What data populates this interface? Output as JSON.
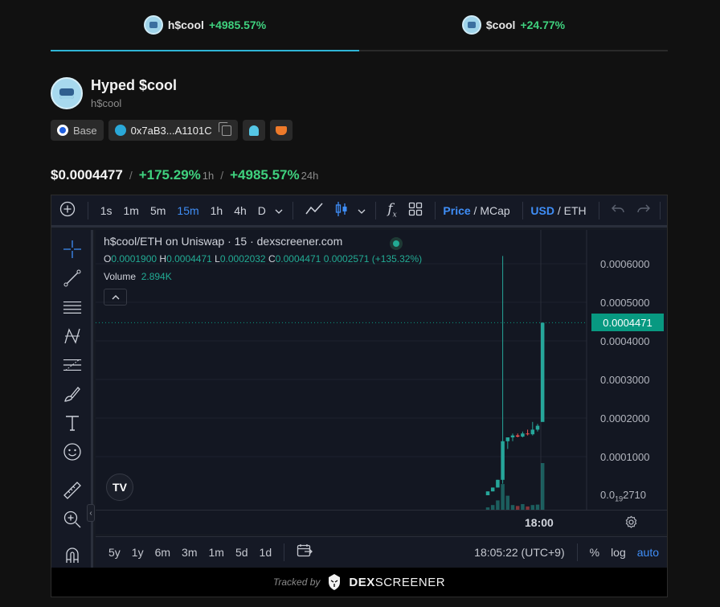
{
  "tabs": [
    {
      "symbol": "h$cool",
      "change": "+4985.57%",
      "active": true
    },
    {
      "symbol": "$cool",
      "change": "+24.77%",
      "active": false
    }
  ],
  "token": {
    "name": "Hyped $cool",
    "symbol": "h$cool",
    "chain": "Base",
    "address": "0x7aB3...A1101C"
  },
  "price": {
    "usd": "$0.0004477",
    "change_1h": "+175.29%",
    "label_1h": "1h",
    "change_24h": "+4985.57%",
    "label_24h": "24h"
  },
  "toolbar": {
    "intervals": [
      "1s",
      "1m",
      "5m",
      "15m",
      "1h",
      "4h",
      "D"
    ],
    "selected_interval": "15m",
    "price_label": "Price",
    "mcap_label": "MCap",
    "usd_label": "USD",
    "eth_label": "ETH"
  },
  "legend": {
    "title": "h$cool/ETH on Uniswap · 15 · dexscreener.com",
    "o_label": "O",
    "o": "0.0001900",
    "h_label": "H",
    "h": "0.0004471",
    "l_label": "L",
    "l": "0.0002032",
    "c_label": "C",
    "c": "0.0004471",
    "change": "0.0002571 (+135.32%)",
    "volume_label": "Volume",
    "volume": "2.894K"
  },
  "chart": {
    "y_ticks": [
      "0.0006000",
      "0.0005000",
      "0.0004000",
      "0.0003000",
      "0.0002000",
      "0.0001000"
    ],
    "low_tick_prefix": "0.0",
    "low_tick_sub": "19",
    "low_tick_suffix": "2710",
    "last_price": "0.0004471",
    "time_label": "18:00",
    "up_color": "#26a69a",
    "down_color": "#ef5350"
  },
  "chart_data": {
    "type": "candlestick",
    "title": "h$cool/ETH on Uniswap · 15 · dexscreener.com",
    "ylim": [
      0,
      0.00065
    ],
    "candles": [
      {
        "o": 0.0,
        "h": 1e-05,
        "l": 0.0,
        "c": 1e-05,
        "v": 0.05
      },
      {
        "o": 1e-05,
        "h": 2e-05,
        "l": 1e-05,
        "c": 2e-05,
        "v": 0.1
      },
      {
        "o": 2e-05,
        "h": 4e-05,
        "l": 2e-05,
        "c": 4e-05,
        "v": 0.2
      },
      {
        "o": 4e-05,
        "h": 0.00062,
        "l": 3e-05,
        "c": 0.00014,
        "v": 0.55
      },
      {
        "o": 0.00014,
        "h": 0.00015,
        "l": 0.00012,
        "c": 0.00015,
        "v": 0.3
      },
      {
        "o": 0.00015,
        "h": 0.00016,
        "l": 0.00014,
        "c": 0.000155,
        "v": 0.1
      },
      {
        "o": 0.000155,
        "h": 0.00016,
        "l": 0.00015,
        "c": 0.000152,
        "v": 0.08
      },
      {
        "o": 0.000152,
        "h": 0.000165,
        "l": 0.00015,
        "c": 0.00016,
        "v": 0.12
      },
      {
        "o": 0.00016,
        "h": 0.00017,
        "l": 0.000155,
        "c": 0.000158,
        "v": 0.07
      },
      {
        "o": 0.000158,
        "h": 0.00019,
        "l": 0.000155,
        "c": 0.00017,
        "v": 0.1
      },
      {
        "o": 0.00017,
        "h": 0.000185,
        "l": 0.000165,
        "c": 0.00018,
        "v": 0.11
      },
      {
        "o": 0.00019,
        "h": 0.0004471,
        "l": 0.0002032,
        "c": 0.0004471,
        "v": 1.0
      }
    ]
  },
  "bottombar": {
    "ranges": [
      "5y",
      "1y",
      "6m",
      "3m",
      "1m",
      "5d",
      "1d"
    ],
    "clock": "18:05:22 (UTC+9)",
    "percent": "%",
    "log": "log",
    "auto": "auto"
  },
  "footer": {
    "tracked_by": "Tracked by",
    "brand_bold": "DEX",
    "brand_light": "SCREENER"
  }
}
